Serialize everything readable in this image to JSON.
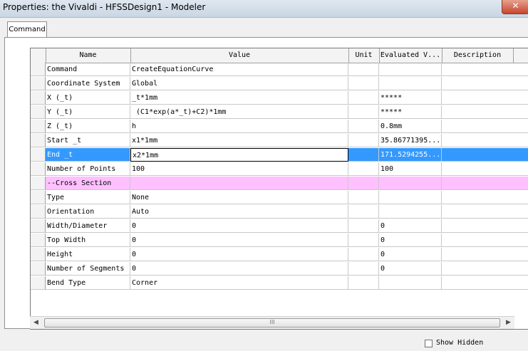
{
  "window": {
    "title": "Properties: the Vivaldi - HFSSDesign1 - Modeler",
    "close_symbol": "✕"
  },
  "tabs": [
    {
      "label": "Command",
      "active": true
    }
  ],
  "table": {
    "columns": [
      "Name",
      "Value",
      "Unit",
      "Evaluated V...",
      "Description"
    ],
    "rows": [
      {
        "name": "Command",
        "value": "CreateEquationCurve",
        "unit": "",
        "evaluated": "",
        "description": ""
      },
      {
        "name": "Coordinate System",
        "value": "Global",
        "unit": "",
        "evaluated": "",
        "description": ""
      },
      {
        "name": "X (_t)",
        "value": "_t*1mm",
        "unit": "",
        "evaluated": "*****",
        "description": ""
      },
      {
        "name": "Y (_t)",
        "value": " (C1*exp(a*_t)+C2)*1mm",
        "unit": "",
        "evaluated": "*****",
        "description": ""
      },
      {
        "name": "Z (_t)",
        "value": "h",
        "unit": "",
        "evaluated": "0.8mm",
        "description": ""
      },
      {
        "name": "Start _t",
        "value": "x1*1mm",
        "unit": "",
        "evaluated": "35.86771395...",
        "description": ""
      },
      {
        "name": "End _t",
        "value": "x2*1mm",
        "unit": "",
        "evaluated": "171.5294255...",
        "description": "",
        "selected": true
      },
      {
        "name": "Number of Points",
        "value": "100",
        "unit": "",
        "evaluated": "100",
        "description": ""
      },
      {
        "name": "--Cross Section",
        "value": "",
        "unit": "",
        "evaluated": "",
        "description": "",
        "section": true
      },
      {
        "name": "Type",
        "value": "None",
        "unit": "",
        "evaluated": "",
        "description": ""
      },
      {
        "name": "Orientation",
        "value": "Auto",
        "unit": "",
        "evaluated": "",
        "description": ""
      },
      {
        "name": "Width/Diameter",
        "value": "0",
        "unit": "",
        "evaluated": "0",
        "description": ""
      },
      {
        "name": "Top Width",
        "value": "0",
        "unit": "",
        "evaluated": "0",
        "description": ""
      },
      {
        "name": "Height",
        "value": "0",
        "unit": "",
        "evaluated": "0",
        "description": ""
      },
      {
        "name": "Number of Segments",
        "value": "0",
        "unit": "",
        "evaluated": "0",
        "description": ""
      },
      {
        "name": "Bend Type",
        "value": "Corner",
        "unit": "",
        "evaluated": "",
        "description": ""
      }
    ]
  },
  "scrollbar": {
    "left_arrow": "◀",
    "right_arrow": "▶",
    "grip": "III"
  },
  "show_hidden": {
    "label": "Show Hidden",
    "checked": false
  },
  "colors": {
    "selection": "#3399ff",
    "section_row": "#ffc0ff"
  }
}
